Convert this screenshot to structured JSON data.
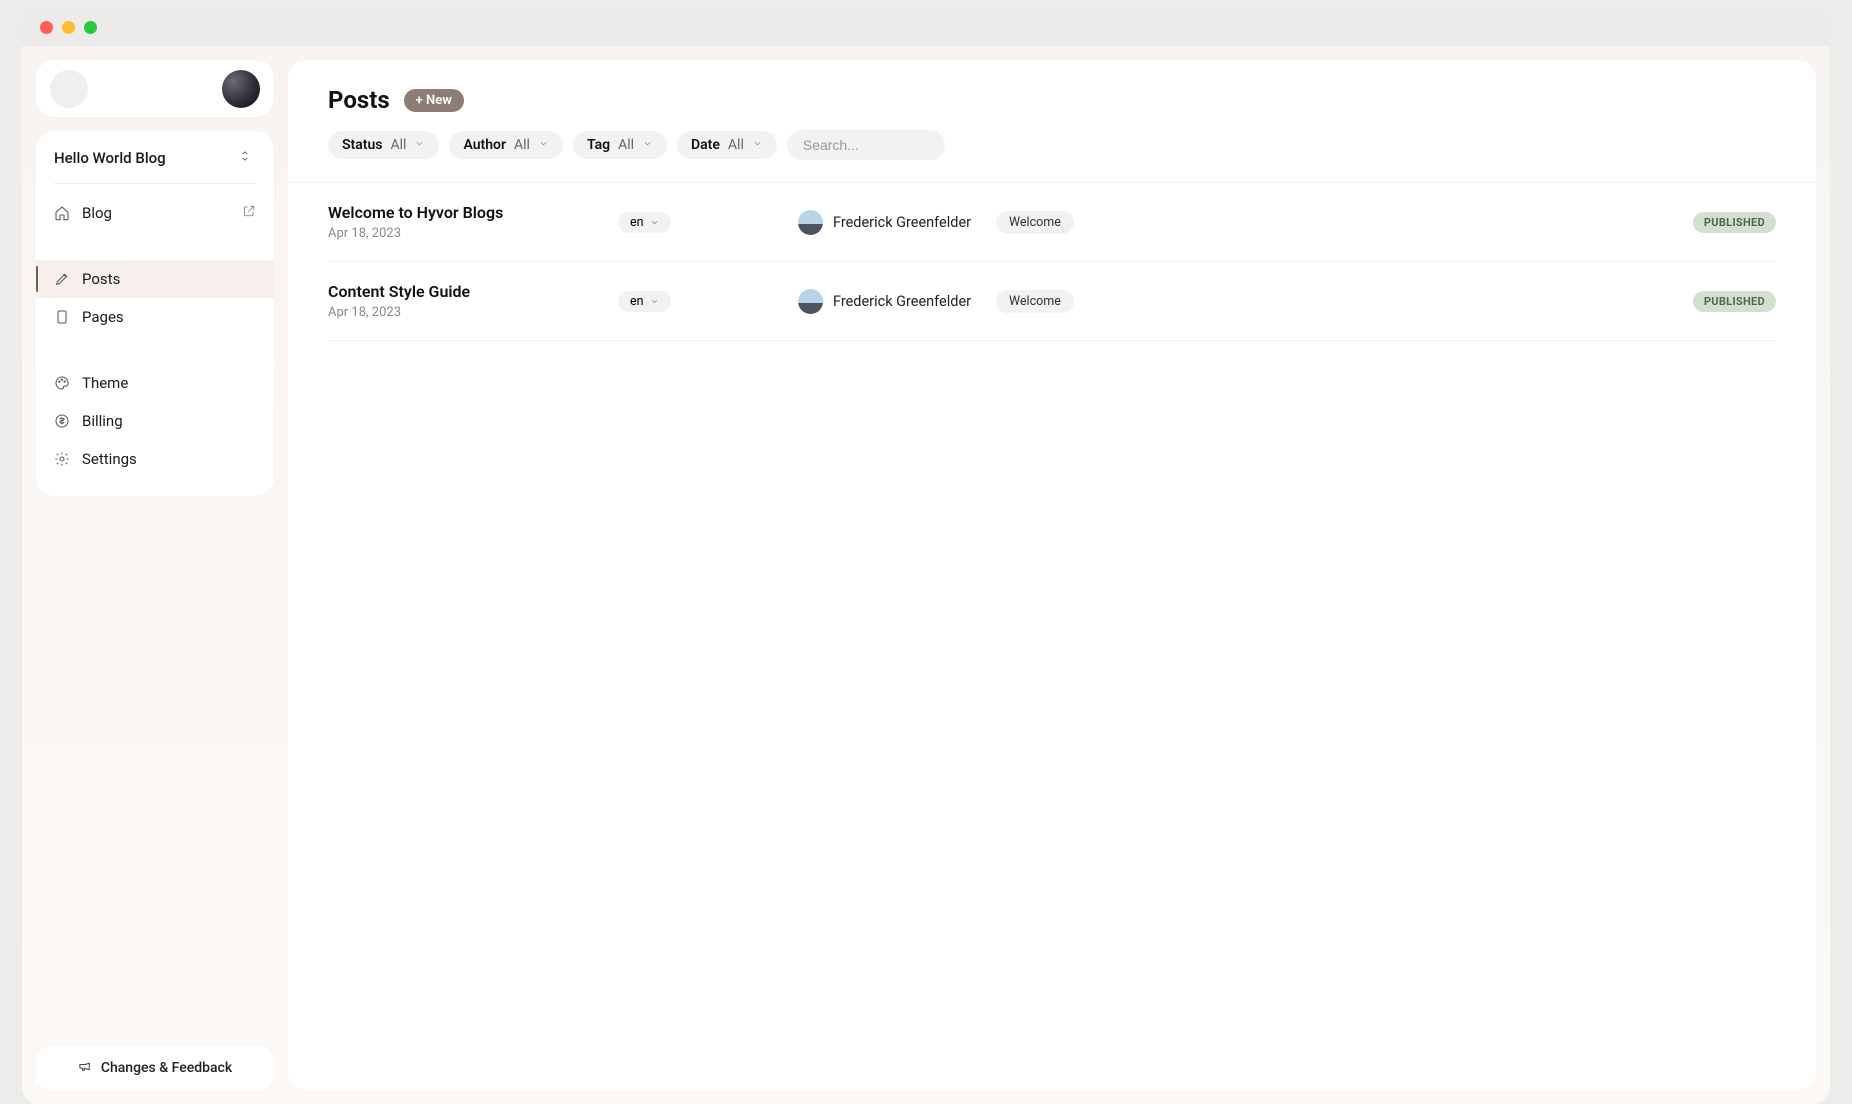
{
  "sidebar": {
    "blog_name": "Hello World Blog",
    "items": [
      {
        "id": "blog",
        "label": "Blog"
      },
      {
        "id": "posts",
        "label": "Posts"
      },
      {
        "id": "pages",
        "label": "Pages"
      },
      {
        "id": "theme",
        "label": "Theme"
      },
      {
        "id": "billing",
        "label": "Billing"
      },
      {
        "id": "settings",
        "label": "Settings"
      }
    ],
    "feedback_label": "Changes & Feedback"
  },
  "header": {
    "title": "Posts",
    "new_button": "+ New"
  },
  "filters": {
    "status": {
      "label": "Status",
      "value": "All"
    },
    "author": {
      "label": "Author",
      "value": "All"
    },
    "tag": {
      "label": "Tag",
      "value": "All"
    },
    "date": {
      "label": "Date",
      "value": "All"
    },
    "search_placeholder": "Search..."
  },
  "posts": [
    {
      "title": "Welcome to Hyvor Blogs",
      "date": "Apr 18, 2023",
      "lang": "en",
      "author": "Frederick Greenfelder",
      "tag": "Welcome",
      "status": "PUBLISHED"
    },
    {
      "title": "Content Style Guide",
      "date": "Apr 18, 2023",
      "lang": "en",
      "author": "Frederick Greenfelder",
      "tag": "Welcome",
      "status": "PUBLISHED"
    }
  ]
}
